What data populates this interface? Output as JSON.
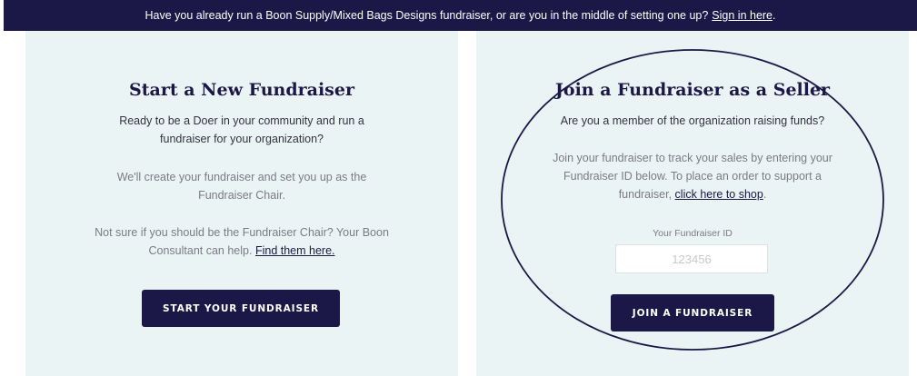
{
  "banner": {
    "text": "Have you already run a Boon Supply/Mixed Bags Designs fundraiser, or are you in the middle of setting one up?",
    "link": "Sign in here",
    "period": "."
  },
  "left_card": {
    "title": "Start a New Fundraiser",
    "para1": "Ready to be a Doer in your community and run a fundraiser for your organization?",
    "para2": "We'll create your fundraiser and set you up as the Fundraiser Chair.",
    "para3": "Not sure if you should be the Fundraiser Chair? Your Boon Consultant can help.",
    "para3_link": "Find them here.",
    "button": "START YOUR FUNDRAISER"
  },
  "right_card": {
    "title": "Join a Fundraiser as a Seller",
    "subtitle": "Are you a member of the organization raising funds?",
    "para": "Join your fundraiser to track your sales by entering your Fundraiser ID below. To place an order to support a fundraiser,",
    "para_link": "click here to shop",
    "para_end": ".",
    "id_label": "Your Fundraiser ID",
    "id_placeholder": "123456",
    "button": "JOIN A FUNDRAISER"
  },
  "colors": {
    "navy": "#1b1847",
    "card_bg": "#ebf4f4",
    "annotation": "#1b1847"
  }
}
